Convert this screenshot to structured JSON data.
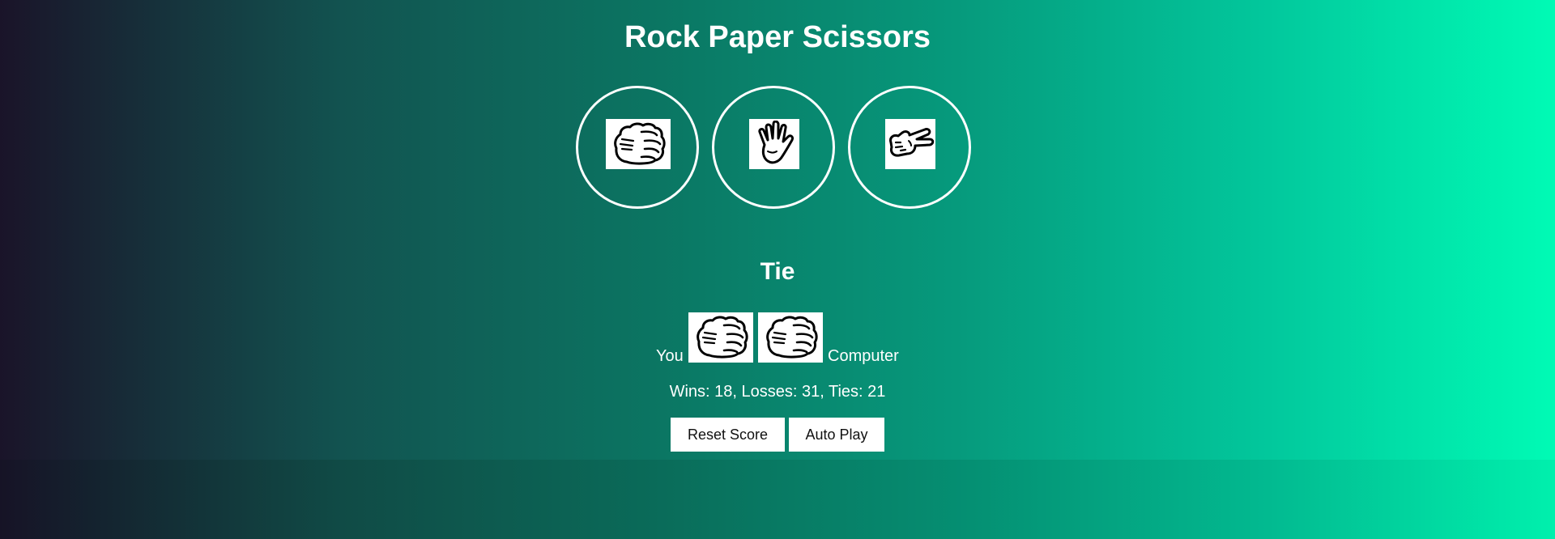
{
  "header": {
    "title": "Rock Paper Scissors"
  },
  "choices": [
    {
      "name": "rock",
      "icon": "rock-fist-icon"
    },
    {
      "name": "paper",
      "icon": "paper-hand-icon"
    },
    {
      "name": "scissors",
      "icon": "scissors-hand-icon"
    }
  ],
  "result": {
    "text": "Tie"
  },
  "moves": {
    "player_label": "You",
    "computer_label": "Computer",
    "player_move": "rock-fist-icon",
    "computer_move": "rock-fist-icon"
  },
  "score": {
    "text": "Wins: 18, Losses: 31, Ties: 21"
  },
  "buttons": {
    "reset_label": "Reset Score",
    "auto_play_label": "Auto Play"
  },
  "colors": {
    "gradient_start": "#1a1429",
    "gradient_end": "#00fbb5",
    "text": "#ffffff",
    "button_bg": "#ffffff"
  }
}
